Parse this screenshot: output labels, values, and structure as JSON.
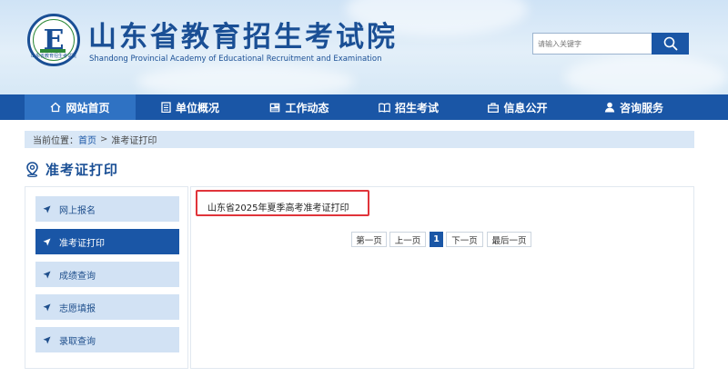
{
  "header": {
    "title": "山东省教育招生考试院",
    "subtitle": "Shandong Provincial Academy of Educational Recruitment and Examination",
    "logo_letter": "E",
    "logo_small_text": "山东省教育招生考试院"
  },
  "search": {
    "placeholder": "请输入关键字",
    "value": ""
  },
  "nav": {
    "items": [
      {
        "label": "网站首页",
        "icon": "home-icon",
        "active": true
      },
      {
        "label": "单位概况",
        "icon": "building-icon"
      },
      {
        "label": "工作动态",
        "icon": "news-icon"
      },
      {
        "label": "招生考试",
        "icon": "book-icon"
      },
      {
        "label": "信息公开",
        "icon": "briefcase-icon"
      },
      {
        "label": "咨询服务",
        "icon": "user-icon"
      }
    ]
  },
  "breadcrumb": {
    "prefix": "当前位置：",
    "home": "首页",
    "separator": ">",
    "current": "准考证打印"
  },
  "page_title": "准考证打印",
  "sidebar": {
    "items": [
      {
        "label": "网上报名"
      },
      {
        "label": "准考证打印",
        "active": true
      },
      {
        "label": "成绩查询"
      },
      {
        "label": "志愿填报"
      },
      {
        "label": "录取查询"
      }
    ]
  },
  "content": {
    "list": [
      {
        "title": "山东省2025年夏季高考准考证打印"
      }
    ]
  },
  "pagination": {
    "first": "第一页",
    "prev": "上一页",
    "current": "1",
    "next": "下一页",
    "last": "最后一页"
  },
  "colors": {
    "primary": "#1a56a6",
    "title": "#1a4f95",
    "highlight": "#e0343a",
    "breadcrumb_bg": "#d9e7f6",
    "sidebar_item_bg": "#d2e2f4"
  }
}
